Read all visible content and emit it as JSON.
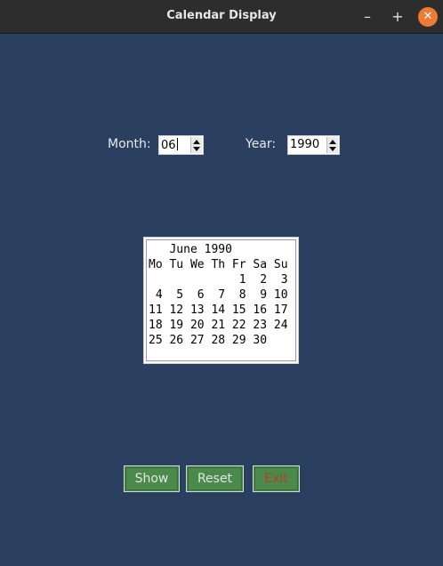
{
  "window": {
    "title": "Calendar Display"
  },
  "controls": {
    "month_label": "Month:",
    "month_value": "06",
    "year_label": "Year:",
    "year_value": "1990"
  },
  "calendar": {
    "text": "   June 1990\nMo Tu We Th Fr Sa Su\n             1  2  3\n 4  5  6  7  8  9 10\n11 12 13 14 15 16 17\n18 19 20 21 22 23 24\n25 26 27 28 29 30"
  },
  "buttons": {
    "show": "Show",
    "reset": "Reset",
    "exit": "Exit"
  },
  "colors": {
    "background": "#2b3f60",
    "button": "#4a8a4b",
    "exit_text": "#c0392b",
    "close": "#ed7a35"
  }
}
